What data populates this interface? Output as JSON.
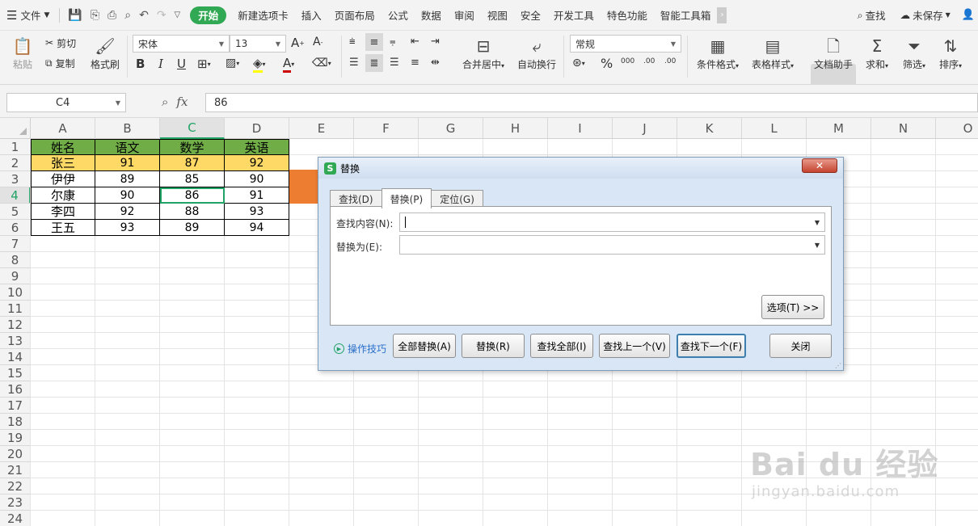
{
  "menubar": {
    "file": "文件",
    "tabs": [
      "开始",
      "新建选项卡",
      "插入",
      "页面布局",
      "公式",
      "数据",
      "审阅",
      "视图",
      "安全",
      "开发工具",
      "特色功能",
      "智能工具箱"
    ],
    "search": "查找",
    "save_status": "未保存"
  },
  "ribbon": {
    "paste": "粘贴",
    "cut": "剪切",
    "copy": "复制",
    "format_painter": "格式刷",
    "font_name": "宋体",
    "font_size": "13",
    "merge_center": "合并居中",
    "wrap_text": "自动换行",
    "number_format": "常规",
    "conditional_format": "条件格式",
    "table_style": "表格样式",
    "doc_assistant": "文档助手",
    "sum": "求和",
    "filter": "筛选",
    "sort": "排序",
    "bold": "B",
    "italic": "I",
    "underline": "U",
    "percent": "%",
    "thousands": "000",
    "dec_inc": ".00",
    "dec_dec": ".00"
  },
  "formula_bar": {
    "cell_ref": "C4",
    "fx": "fx",
    "value": "86"
  },
  "sheet": {
    "columns": [
      "A",
      "B",
      "C",
      "D",
      "E",
      "F",
      "G",
      "H",
      "I",
      "J",
      "K",
      "L",
      "M",
      "N",
      "O"
    ],
    "rows": [
      "1",
      "2",
      "3",
      "4",
      "5",
      "6",
      "7",
      "8",
      "9",
      "10",
      "11",
      "12",
      "13",
      "14",
      "15",
      "16",
      "17",
      "18",
      "19",
      "20",
      "21",
      "22",
      "23",
      "24"
    ],
    "header": [
      "姓名",
      "语文",
      "数学",
      "英语"
    ],
    "data": [
      [
        "张三",
        "91",
        "87",
        "92"
      ],
      [
        "伊伊",
        "89",
        "85",
        "90"
      ],
      [
        "尔康",
        "90",
        "86",
        "91"
      ],
      [
        "李四",
        "92",
        "88",
        "93"
      ],
      [
        "王五",
        "93",
        "89",
        "94"
      ]
    ],
    "colors": {
      "header_bg": "#70ad47",
      "highlight_row": "#ffd966",
      "accent": "#21a366",
      "orange": "#ed7d31"
    }
  },
  "dialog": {
    "title": "替换",
    "logo": "S",
    "close_icon": "✕",
    "tabs": [
      "查找(D)",
      "替换(P)",
      "定位(G)"
    ],
    "find_label": "查找内容(N):",
    "find_value": "",
    "replace_label": "替换为(E):",
    "replace_value": "",
    "options_button": "选项(T) >>",
    "tips": "操作技巧",
    "buttons": {
      "replace_all": "全部替换(A)",
      "replace": "替换(R)",
      "find_all": "查找全部(I)",
      "find_prev": "查找上一个(V)",
      "find_next": "查找下一个(F)",
      "close": "关闭"
    }
  },
  "watermark": {
    "brand": "Bai du 经验",
    "url": "jingyan.baidu.com"
  }
}
